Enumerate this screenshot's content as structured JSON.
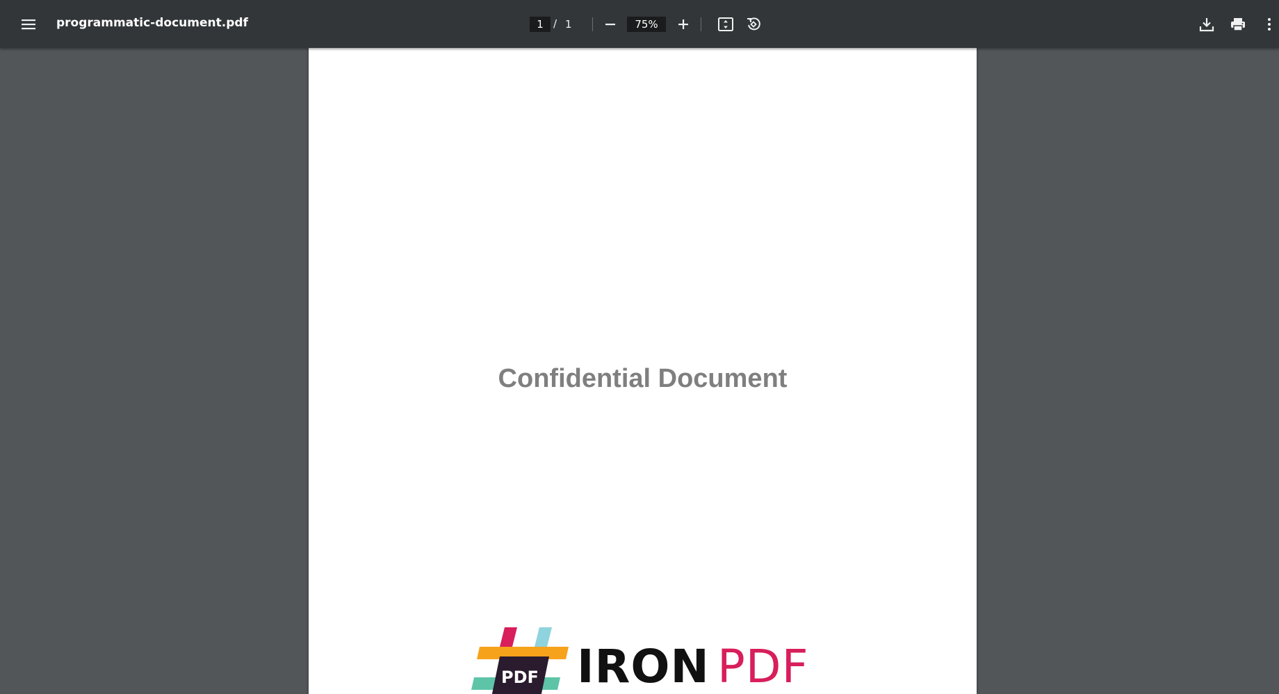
{
  "toolbar": {
    "menu_icon": "hamburger-menu-icon",
    "title": "programmatic-document.pdf",
    "current_page": "1",
    "page_separator": "/",
    "total_pages": "1",
    "zoom_out_icon": "minus-icon",
    "zoom_level": "75%",
    "zoom_in_icon": "plus-icon",
    "fit_icon": "fit-to-page-icon",
    "rotate_icon": "rotate-counterclockwise-icon",
    "download_icon": "download-icon",
    "print_icon": "print-icon",
    "more_icon": "more-vertical-icon"
  },
  "document": {
    "watermark_text": "Confidential Document",
    "logo": {
      "mark_text": "PDF",
      "word_dark": "IRON",
      "word_accent": "PDF"
    }
  },
  "colors": {
    "toolbar_bg": "#323639",
    "viewer_bg": "#525659",
    "page_bg": "#ffffff",
    "watermark": "#7f7f7f",
    "logo_accent": "#d81e5b",
    "logo_orange": "#f7a21b",
    "logo_teal": "#5ec4a8",
    "logo_light_blue": "#8fd3df",
    "logo_dark": "#2b1b2e"
  }
}
